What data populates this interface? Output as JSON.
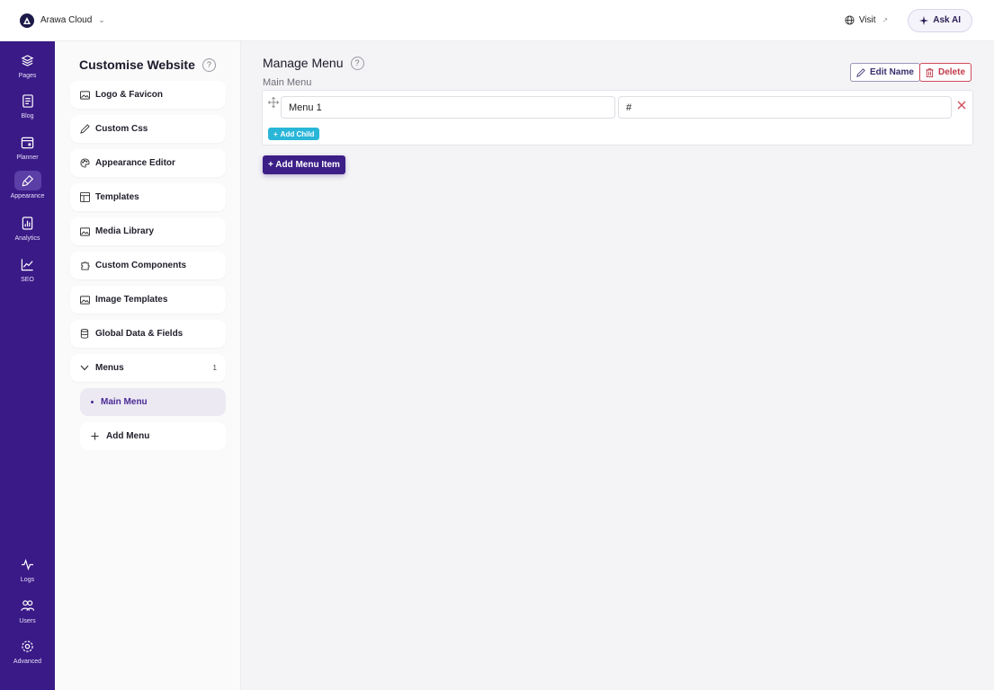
{
  "topbar": {
    "workspace_name": "Arawa Cloud",
    "visit_label": "Visit",
    "ask_ai_label": "Ask AI"
  },
  "rail": {
    "items": [
      {
        "label": "Pages",
        "icon": "layers-icon"
      },
      {
        "label": "Blog",
        "icon": "document-icon"
      },
      {
        "label": "Planner",
        "icon": "calendar-icon"
      },
      {
        "label": "Appearance",
        "icon": "brush-icon",
        "active": true
      },
      {
        "label": "Analytics",
        "icon": "chart-file-icon"
      },
      {
        "label": "SEO",
        "icon": "trend-icon"
      },
      {
        "label": "Logs",
        "icon": "pulse-icon"
      },
      {
        "label": "Users",
        "icon": "users-icon"
      },
      {
        "label": "Advanced",
        "icon": "gear-icon"
      }
    ]
  },
  "panel": {
    "title": "Customise Website",
    "help": "?",
    "items": [
      {
        "label": "Logo & Favicon",
        "icon": "image-icon"
      },
      {
        "label": "Custom Css",
        "icon": "pencil-icon"
      },
      {
        "label": "Appearance Editor",
        "icon": "palette-icon"
      },
      {
        "label": "Templates",
        "icon": "layout-icon"
      },
      {
        "label": "Media Library",
        "icon": "image-icon"
      },
      {
        "label": "Custom Components",
        "icon": "puzzle-icon"
      },
      {
        "label": "Image Templates",
        "icon": "image-icon"
      },
      {
        "label": "Global Data & Fields",
        "icon": "database-icon"
      },
      {
        "label": "Menus",
        "icon": "chevron-down-icon",
        "count": "1"
      }
    ],
    "submenu": {
      "active_label": "Main Menu",
      "add_label": "Add Menu"
    }
  },
  "main": {
    "title": "Manage Menu",
    "help": "?",
    "menu_name": "Main Menu",
    "edit_name_label": "Edit Name",
    "delete_label": "Delete",
    "item": {
      "name_value": "Menu 1",
      "url_value": "#",
      "add_child_label": "Add Child"
    },
    "add_item_label": "+ Add Menu Item"
  },
  "colors": {
    "rail_bg": "#3a1a87",
    "primary": "#3b1e86",
    "add_child": "#29b6d8",
    "danger": "#c03a4a"
  }
}
